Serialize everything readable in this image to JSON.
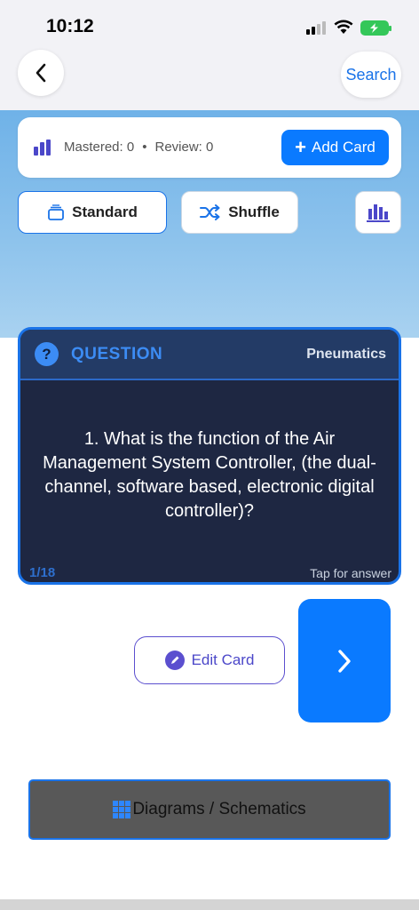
{
  "status_bar": {
    "time": "10:12"
  },
  "nav": {
    "search_label": "Search"
  },
  "stats": {
    "mastered": "Mastered: 0",
    "separator": "•",
    "review": "Review: 0",
    "add_card_label": "Add Card"
  },
  "modes": {
    "standard_label": "Standard",
    "shuffle_label": "Shuffle"
  },
  "question_card": {
    "header_label": "QUESTION",
    "category": "Pneumatics",
    "text": "1. What is the function of the Air Management System Controller, (the dual- channel, software based, electronic digital controller)?",
    "counter": "1/18",
    "hint": "Tap for answer"
  },
  "actions": {
    "edit_label": "Edit Card"
  },
  "footer": {
    "diagrams_label": "Diagrams / Schematics"
  },
  "colors": {
    "accent": "#0a7aff",
    "card_bg": "#1e2742",
    "indigo": "#4b47c9"
  },
  "icons": [
    "back-chevron-icon",
    "bar-chart-icon",
    "plus-icon",
    "stack-icon",
    "shuffle-icon",
    "stats-icon",
    "question-icon",
    "pencil-icon",
    "chevron-right-icon",
    "grid-icon"
  ]
}
